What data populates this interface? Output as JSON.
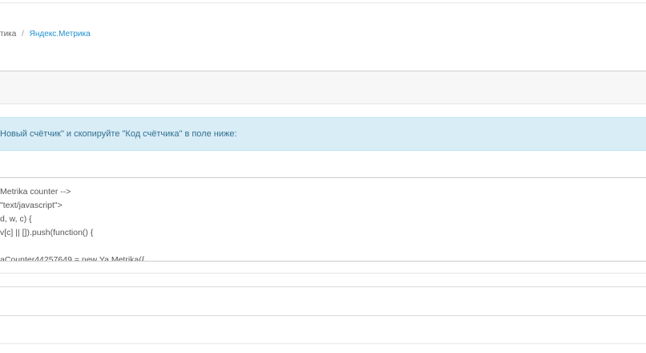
{
  "breadcrumb": {
    "parent": "тика",
    "separator": "/",
    "current": "Яндекс.Метрика"
  },
  "alert": {
    "text": "Новый счётчик\" и скопируйте \"Код счётчика\" в поле ниже:"
  },
  "code_field": {
    "lines": [
      "Metrika counter -->",
      "\"text/javascript\">",
      "d, w, c) {",
      "v[c] || []).push(function() {",
      "",
      "aCounter44257649 = new Ya.Metrika({"
    ]
  },
  "colors": {
    "link": "#1e91cf",
    "alert_bg": "#d9edf7",
    "alert_text": "#31708f"
  }
}
